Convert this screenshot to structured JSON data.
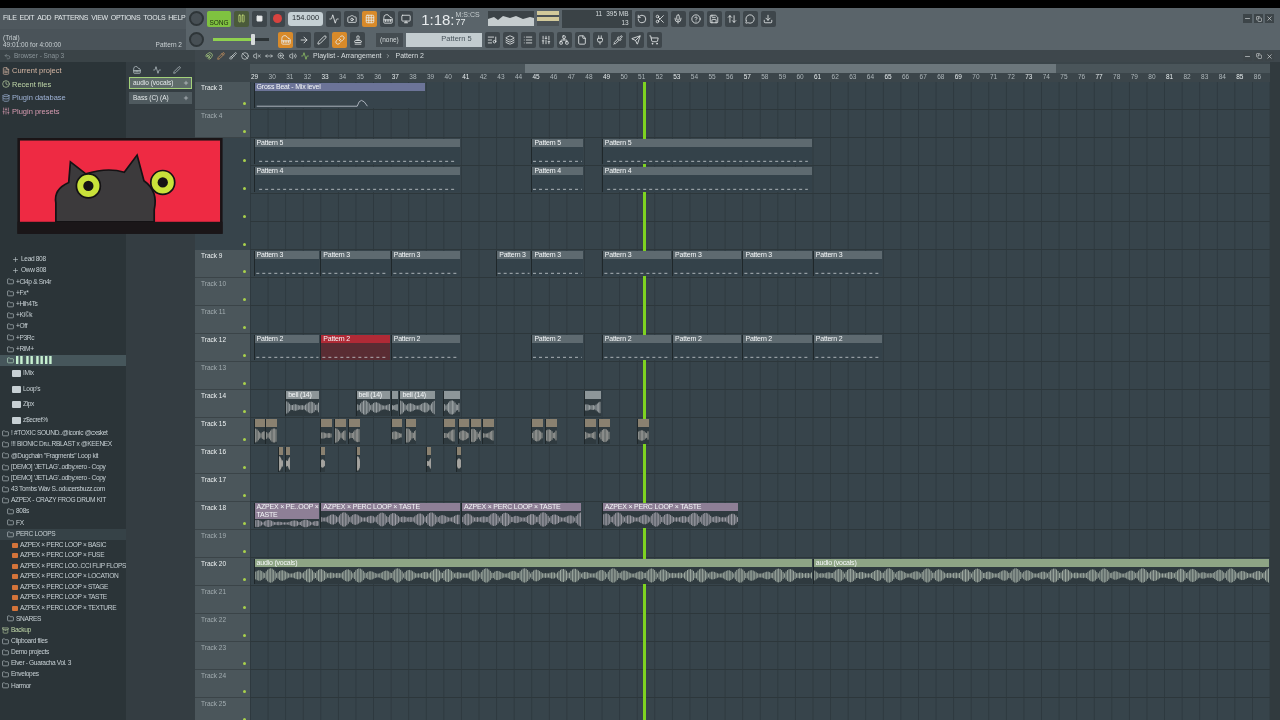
{
  "menu": [
    "FILE",
    "EDIT",
    "ADD",
    "PATTERNS",
    "VIEW",
    "OPTIONS",
    "TOOLS",
    "HELP"
  ],
  "hint": {
    "title": "(Trial)",
    "text": "49:01:00 for 4:00:00",
    "pattern": "Pattern 2"
  },
  "transport": {
    "song_mode": {
      "label": "SONG",
      "on": true
    },
    "playing": true,
    "tempo": "154.000",
    "master_volume": {
      "level": 0.72
    }
  },
  "time": {
    "main": "1:18:",
    "centis": "77",
    "unit": "M:S:CS"
  },
  "monitor": {
    "cpu": "11",
    "memory": "395 MB",
    "polyphony": "13"
  },
  "pattern_selector": {
    "snap": "(none)",
    "pattern": "Pattern 5"
  },
  "browser": {
    "title": "Browser - Snap 3",
    "items_top": [
      {
        "label": "Current project",
        "kind": "project",
        "selected": false
      },
      {
        "label": "Recent files",
        "kind": "recent",
        "selected": false
      },
      {
        "label": "Plugin database",
        "kind": "plugins",
        "selected": false
      },
      {
        "label": "Plugin presets",
        "kind": "presets",
        "selected": false
      }
    ],
    "items_bottom": [
      {
        "kind": "group",
        "children": [
          {
            "kind": "group",
            "children": [
              {
                "label": "Lead 808",
                "kind": "plugin",
                "selected": false
              },
              {
                "label": "Oww 808",
                "kind": "plugin",
                "selected": false
              }
            ]
          },
          {
            "label": "+Cl4p & Sn4r",
            "kind": "folder",
            "selected": false
          },
          {
            "label": "+Fx*",
            "kind": "folder",
            "selected": false
          },
          {
            "label": "+Hih4Ts",
            "kind": "folder",
            "selected": false
          },
          {
            "label": "+Ki©k",
            "kind": "folder",
            "selected": false
          },
          {
            "label": "+Off",
            "kind": "folder",
            "selected": false
          },
          {
            "label": "+P3Rc",
            "kind": "folder",
            "selected": false
          },
          {
            "label": "+RiM+",
            "kind": "folder",
            "selected": false
          },
          {
            "label": "▌▌ ▌▌ ▌▌▌▌",
            "kind": "folder",
            "selected": true,
            "children": [
              {
                "label": "IMix",
                "kind": "pack",
                "selected": false
              },
              {
                "label": "Loop's",
                "kind": "pack",
                "selected": false
              },
              {
                "label": "Zipx",
                "kind": "pack",
                "selected": false
              },
              {
                "label": "z$ecret%",
                "kind": "pack",
                "selected": false
              }
            ]
          }
        ]
      },
      {
        "label": "! #TOXIC SOUND..@iconic @cxsket",
        "kind": "folder",
        "selected": false
      },
      {
        "label": "!!! BIONIC Dru..RBLAST x @KEENEX",
        "kind": "folder",
        "selected": false
      },
      {
        "label": "@Dugchain \"Fragments\" Loop kit",
        "kind": "folder",
        "selected": false
      },
      {
        "label": "[DEMO] 'JETLAG'..odby.xero - Copy",
        "kind": "folder",
        "selected": false
      },
      {
        "label": "[DEMO] 'JETLAG'..odby.xero - Copy",
        "kind": "folder",
        "selected": false
      },
      {
        "label": "43 Tombs Wav S..oducersbuzz.com",
        "kind": "folder",
        "selected": false
      },
      {
        "label": "AZPEX - CRAZY FROG DRUM KIT",
        "kind": "folder",
        "selected": false,
        "children": [
          {
            "label": "808s",
            "kind": "folder",
            "selected": false
          },
          {
            "label": "FX",
            "kind": "folder",
            "selected": false
          },
          {
            "label": "PERC LOOPS",
            "kind": "folder",
            "selected": false,
            "children": [
              {
                "label": "AZPEX × PERC LOOP × BASIC",
                "kind": "file",
                "selected": false
              },
              {
                "label": "AZPEX × PERC LOOP × FUSE",
                "kind": "file",
                "selected": false
              },
              {
                "label": "AZPEX × PERC LOO..CCI FLIP FLOPS",
                "kind": "file",
                "selected": false
              },
              {
                "label": "AZPEX × PERC LOOP × LOCATION",
                "kind": "file",
                "selected": false
              },
              {
                "label": "AZPEX × PERC LOOP × STAGE",
                "kind": "file",
                "selected": false
              },
              {
                "label": "AZPEX × PERC LOOP × TASTE",
                "kind": "file",
                "selected": false
              },
              {
                "label": "AZPEX × PERC LOOP × TEXTURE",
                "kind": "file",
                "selected": false
              }
            ]
          },
          {
            "label": "SNARES",
            "kind": "folder",
            "selected": false
          }
        ]
      },
      {
        "label": "Backup",
        "kind": "backup",
        "selected": false
      },
      {
        "label": "Clipboard files",
        "kind": "folder",
        "selected": false
      },
      {
        "label": "Demo projects",
        "kind": "folder",
        "selected": false
      },
      {
        "label": "Elver - Guaracha Vol. 3",
        "kind": "folder",
        "selected": false
      },
      {
        "label": "Envelopes",
        "kind": "folder",
        "selected": false
      },
      {
        "label": "Harmor",
        "kind": "folder",
        "selected": false
      }
    ]
  },
  "channel_rack": {
    "channels": [
      {
        "name": "audio (vocals)",
        "selected": true
      },
      {
        "name": "Bass (C) (A)",
        "selected": false
      }
    ]
  },
  "playlist": {
    "title": "Playlist - Arrangement",
    "crumb": "Pattern 2",
    "ruler": [
      "29",
      "30",
      "31",
      "32",
      "33",
      "34",
      "35",
      "36",
      "37",
      "38",
      "39",
      "40",
      "41",
      "42",
      "43",
      "44",
      "45",
      "46",
      "47",
      "48",
      "49",
      "50",
      "51",
      "52",
      "53",
      "54",
      "55",
      "56",
      "57",
      "58",
      "59",
      "60",
      "61",
      "62",
      "63",
      "64",
      "65",
      "66",
      "67",
      "68",
      "69",
      "70",
      "71",
      "72",
      "73",
      "74",
      "75",
      "76",
      "77",
      "78",
      "79",
      "80",
      "81",
      "82",
      "83",
      "84",
      "85",
      "86"
    ],
    "playhead": {
      "level": 0.386
    },
    "tracks": [
      {
        "name": "Track 3",
        "dimmed": false,
        "clips": [
          {
            "kind": "automation",
            "label": "Gross Beat - Mix level",
            "selected": false
          }
        ]
      },
      {
        "name": "Track 4",
        "dimmed": true
      },
      {
        "clips": [
          {
            "kind": "pattern",
            "label": "Pattern 5",
            "selected": false
          },
          {
            "kind": "pattern",
            "label": "Pattern 5",
            "selected": false
          },
          {
            "kind": "pattern",
            "label": "Pattern 5",
            "selected": false
          }
        ]
      },
      {
        "clips": [
          {
            "kind": "pattern",
            "label": "Pattern 4",
            "selected": false
          },
          {
            "kind": "pattern",
            "label": "Pattern 4",
            "selected": false
          },
          {
            "kind": "pattern",
            "label": "Pattern 4",
            "selected": false
          }
        ]
      },
      {
        "name": "Track 9",
        "dimmed": false,
        "clips": [
          {
            "kind": "pattern",
            "label": "Pattern 3",
            "selected": false
          },
          {
            "kind": "pattern",
            "label": "Pattern 3",
            "selected": false
          },
          {
            "kind": "pattern",
            "label": "Pattern 3",
            "selected": false
          },
          {
            "kind": "pattern",
            "label": "Pattern 3",
            "selected": false
          },
          {
            "kind": "pattern",
            "label": "Pattern 3",
            "selected": false
          },
          {
            "kind": "pattern",
            "label": "Pattern 3",
            "selected": false
          },
          {
            "kind": "pattern",
            "label": "Pattern 3",
            "selected": false
          },
          {
            "kind": "pattern",
            "label": "Pattern 3",
            "selected": false
          },
          {
            "kind": "pattern",
            "label": "Pattern 3",
            "selected": false
          }
        ]
      },
      {
        "name": "Track 10",
        "dimmed": true
      },
      {
        "name": "Track 11",
        "dimmed": true
      },
      {
        "name": "Track 12",
        "dimmed": false,
        "clips": [
          {
            "kind": "pattern",
            "label": "Pattern 2",
            "selected": false
          },
          {
            "kind": "pattern",
            "label": "Pattern 2",
            "selected": true
          },
          {
            "kind": "pattern",
            "label": "Pattern 2",
            "selected": false
          },
          {
            "kind": "pattern",
            "label": "Pattern 2",
            "selected": false
          },
          {
            "kind": "pattern",
            "label": "Pattern 2",
            "selected": false
          },
          {
            "kind": "pattern",
            "label": "Pattern 2",
            "selected": false
          },
          {
            "kind": "pattern",
            "label": "Pattern 2",
            "selected": false
          },
          {
            "kind": "pattern",
            "label": "Pattern 2",
            "selected": false
          }
        ]
      },
      {
        "name": "Track 13",
        "dimmed": true
      },
      {
        "name": "Track 14",
        "dimmed": false,
        "clips": [
          {
            "kind": "audio",
            "label": "bell (14)",
            "color": "#8d9699",
            "selected": false
          },
          {
            "kind": "audio",
            "label": "bell (14)",
            "color": "#8d9699",
            "selected": false
          },
          {
            "kind": "audio",
            "color": "#8d9699",
            "selected": false
          },
          {
            "kind": "audio",
            "label": "bell (14)",
            "color": "#8d9699",
            "selected": false
          },
          {
            "kind": "audio",
            "color": "#8d9699",
            "selected": false
          },
          {
            "kind": "audio",
            "color": "#8d9699",
            "selected": false
          }
        ]
      },
      {
        "name": "Track 15",
        "dimmed": false,
        "clips": [
          {
            "kind": "audio",
            "color": "#8a8170",
            "selected": false
          },
          {
            "kind": "audio",
            "color": "#8a8170",
            "selected": false
          },
          {
            "kind": "audio",
            "color": "#8a8170",
            "selected": false
          },
          {
            "kind": "audio",
            "color": "#8a8170",
            "selected": false
          },
          {
            "kind": "audio",
            "color": "#8a8170",
            "selected": false
          },
          {
            "kind": "audio",
            "color": "#8a8170",
            "selected": false
          },
          {
            "kind": "audio",
            "color": "#8a8170",
            "selected": false
          },
          {
            "kind": "audio",
            "color": "#8a8170",
            "selected": false
          },
          {
            "kind": "audio",
            "color": "#8a8170",
            "selected": false
          },
          {
            "kind": "audio",
            "color": "#8a8170",
            "selected": false
          },
          {
            "kind": "audio",
            "color": "#8a8170",
            "selected": false
          },
          {
            "kind": "audio",
            "color": "#8a8170",
            "selected": false
          },
          {
            "kind": "audio",
            "color": "#8a8170",
            "selected": false
          },
          {
            "kind": "audio",
            "color": "#8a8170",
            "selected": false
          },
          {
            "kind": "audio",
            "color": "#8a8170",
            "selected": false
          },
          {
            "kind": "audio",
            "color": "#8a8170",
            "selected": false
          }
        ]
      },
      {
        "name": "Track 16",
        "dimmed": false,
        "clips": [
          {
            "kind": "audio",
            "color": "#8a8170",
            "selected": false
          },
          {
            "kind": "audio",
            "color": "#8a8170",
            "selected": false
          },
          {
            "kind": "audio",
            "color": "#8a8170",
            "selected": false
          },
          {
            "kind": "audio",
            "color": "#8a8170",
            "selected": false
          },
          {
            "kind": "audio",
            "color": "#8a8170",
            "selected": false
          },
          {
            "kind": "audio",
            "color": "#8a8170",
            "selected": false
          }
        ]
      },
      {
        "name": "Track 17",
        "dimmed": false
      },
      {
        "name": "Track 18",
        "dimmed": false,
        "clips": [
          {
            "kind": "audio",
            "label": "AZPEX × PE..OOP × TASTE",
            "color": "#8e7f96",
            "selected": false
          },
          {
            "kind": "audio",
            "label": "AZPEX × PERC LOOP × TASTE",
            "color": "#8e7f96",
            "selected": false
          },
          {
            "kind": "audio",
            "label": "AZPEX × PERC LOOP × TASTE",
            "color": "#8e7f96",
            "selected": false
          },
          {
            "kind": "audio",
            "label": "AZPEX × PERC LOOP × TASTE",
            "color": "#8e7f96",
            "selected": false
          }
        ]
      },
      {
        "name": "Track 19",
        "dimmed": true
      },
      {
        "name": "Track 20",
        "dimmed": false,
        "clips": [
          {
            "kind": "audio",
            "label": "audio (vocals)",
            "color": "#8ea585",
            "selected": false
          },
          {
            "kind": "audio",
            "label": "audio (vocals)",
            "color": "#8ea585",
            "selected": false
          }
        ]
      },
      {
        "name": "Track 21",
        "dimmed": true
      },
      {
        "name": "Track 22",
        "dimmed": true
      },
      {
        "name": "Track 23",
        "dimmed": true
      },
      {
        "name": "Track 24",
        "dimmed": true
      },
      {
        "name": "Track 25",
        "dimmed": true
      }
    ]
  }
}
